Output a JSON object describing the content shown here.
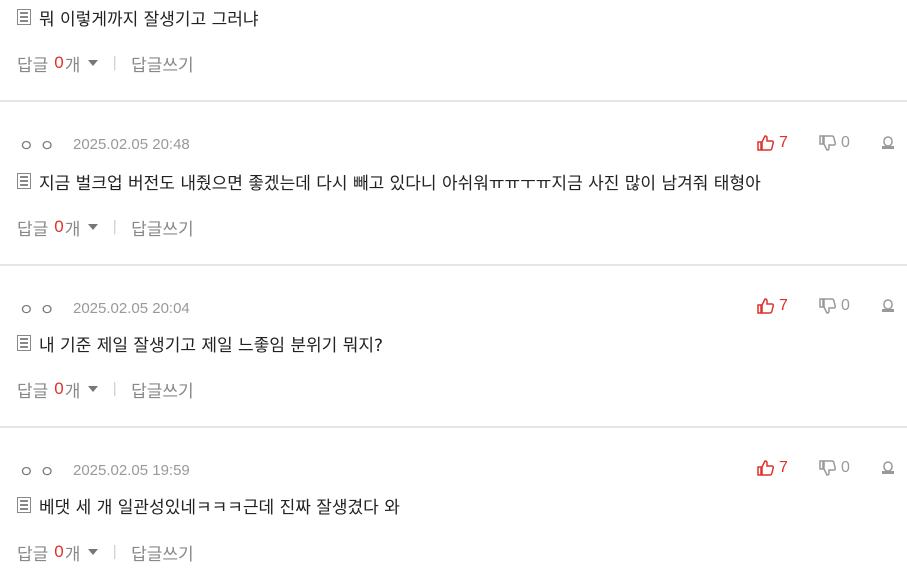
{
  "comments": [
    {
      "text": "뭐 이렇게까지 잘생기고 그러냐",
      "reply_label": "답글",
      "reply_count": "0",
      "reply_unit": "개",
      "write_label": "답글쓰기"
    },
    {
      "nickname": "ㅇㅇ",
      "date": "2025.02.05 20:48",
      "likes": "7",
      "dislikes": "0",
      "text": "지금 벌크업 버전도 내줬으면 좋겠는데 다시 빼고 있다니 아쉬워ㅠㅠㅜㅠ지금 사진 많이 남겨줘 태형아",
      "reply_label": "답글",
      "reply_count": "0",
      "reply_unit": "개",
      "write_label": "답글쓰기"
    },
    {
      "nickname": "ㅇㅇ",
      "date": "2025.02.05 20:04",
      "likes": "7",
      "dislikes": "0",
      "text": "내 기준 제일 잘생기고 제일 느좋임 분위기 뭐지?",
      "reply_label": "답글",
      "reply_count": "0",
      "reply_unit": "개",
      "write_label": "답글쓰기"
    },
    {
      "nickname": "ㅇㅇ",
      "date": "2025.02.05 19:59",
      "likes": "7",
      "dislikes": "0",
      "text": "베댓 세 개 일관성있네ㅋㅋㅋ근데 진짜 잘생겼다 와",
      "reply_label": "답글",
      "reply_count": "0",
      "reply_unit": "개",
      "write_label": "답글쓰기"
    }
  ],
  "icons": {
    "like": "thumbs-up-icon",
    "dislike": "thumbs-down-icon",
    "report": "report-icon",
    "comment_body": "document-icon",
    "reply_toggle": "caret-down-icon"
  },
  "colors": {
    "accent_red": "#e0302b",
    "muted": "#999999",
    "divider": "#e5e5e5"
  }
}
